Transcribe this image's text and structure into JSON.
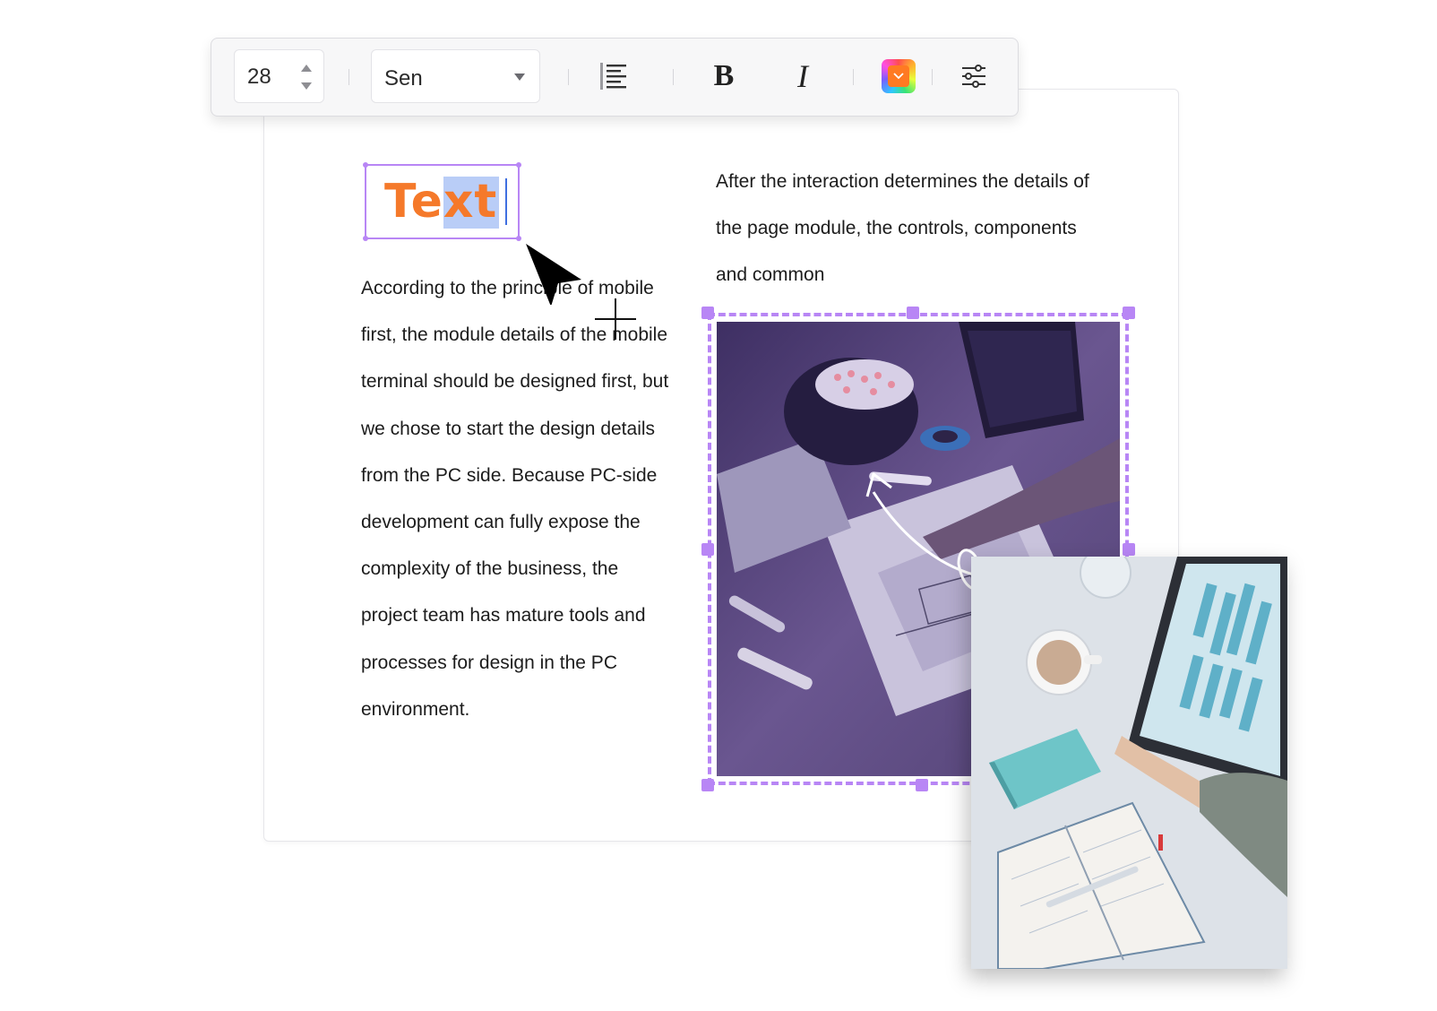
{
  "toolbar": {
    "font_size": "28",
    "font_family": "Sen",
    "bold_label": "B",
    "italic_label": "I",
    "text_color": "#ff7a22"
  },
  "text_element": {
    "value": "Text",
    "color": "#f5792a"
  },
  "paragraph_left": [
    "According to the principle of mobile",
    "first, the module details of the mobile",
    "terminal should be designed first, but",
    "we chose to start the design details",
    "from the PC side. Because PC-side",
    "development can fully expose the",
    "complexity of the business, the",
    "project team has mature tools and",
    "processes for design in the PC",
    "environment."
  ],
  "paragraph_right": [
    "After the interaction determines the details of",
    "the page module, the controls, components",
    "and common"
  ],
  "icons": {
    "align": "align-left-icon",
    "settings": "sliders-icon",
    "pointer": "mouse-pointer-icon",
    "crosshair": "crosshair-icon"
  },
  "colors": {
    "selection": "#b886f5",
    "accent_orange": "#f5792a",
    "highlight": "#b9cdf7",
    "caret": "#3f6fe0"
  }
}
